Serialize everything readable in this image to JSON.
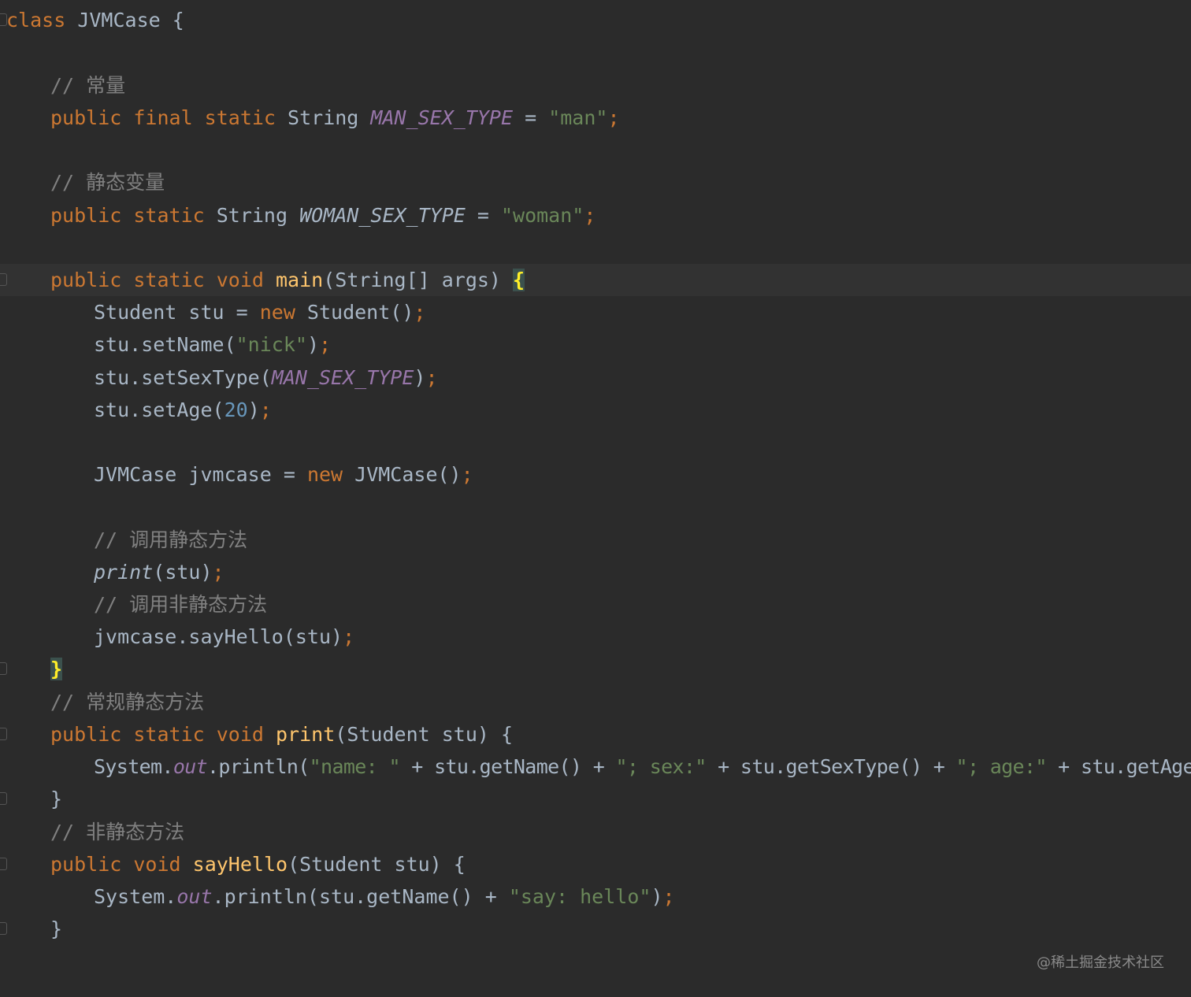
{
  "editor": {
    "lines": {
      "l1": {
        "class_kw": "class",
        "class_name": " JVMCase {"
      },
      "l3": {
        "comment": "// 常量"
      },
      "l4": {
        "kw": "public final static",
        "type": " String ",
        "const": "MAN_SEX_TYPE",
        "eq": " = ",
        "str": "\"man\"",
        "semi": ";"
      },
      "l6": {
        "comment": "// 静态变量"
      },
      "l7": {
        "kw": "public static",
        "type": " String ",
        "sfield": "WOMAN_SEX_TYPE",
        "eq": " = ",
        "str": "\"woman\"",
        "semi": ";"
      },
      "l9": {
        "kw": "public static void",
        "sp": " ",
        "fn": "main",
        "args": "(String[] args) ",
        "brace": "{"
      },
      "l10": {
        "text": "Student stu = ",
        "kw": "new",
        "rest": " Student()",
        "semi": ";"
      },
      "l11": {
        "text": "stu.setName(",
        "str": "\"nick\"",
        "close": ")",
        "semi": ";"
      },
      "l12": {
        "text": "stu.setSexType(",
        "const": "MAN_SEX_TYPE",
        "close": ")",
        "semi": ";"
      },
      "l13": {
        "text": "stu.setAge(",
        "num": "20",
        "close": ")",
        "semi": ";"
      },
      "l15": {
        "text": "JVMCase jvmcase = ",
        "kw": "new",
        "rest": " JVMCase()",
        "semi": ";"
      },
      "l17": {
        "comment": "// 调用静态方法"
      },
      "l18": {
        "call": "print",
        "rest": "(stu)",
        "semi": ";"
      },
      "l19": {
        "comment": "// 调用非静态方法"
      },
      "l20": {
        "text": "jvmcase.sayHello(stu)",
        "semi": ";"
      },
      "l21": {
        "brace": "}"
      },
      "l22": {
        "comment": "// 常规静态方法"
      },
      "l23": {
        "kw": "public static void",
        "sp": " ",
        "fn": "print",
        "rest": "(Student stu) {"
      },
      "l24": {
        "sys": "System.",
        "field": "out",
        "p1": ".println(",
        "s1": "\"name: \"",
        "p2": " + stu.getName() + ",
        "s2": "\"; sex:\"",
        "p3": " + stu.getSexType() + ",
        "s3": "\"; age:\"",
        "p4": " + stu.getAge())",
        "semi": ";"
      },
      "l25": {
        "brace": "}"
      },
      "l26": {
        "comment": "// 非静态方法"
      },
      "l27": {
        "kw": "public void",
        "sp": " ",
        "fn": "sayHello",
        "rest": "(Student stu) {"
      },
      "l28": {
        "sys": "System.",
        "field": "out",
        "p1": ".println(stu.getName() + ",
        "s1": "\"say: hello\"",
        "close": ")",
        "semi": ";"
      },
      "l29": {
        "brace": "}"
      }
    }
  },
  "watermark": "@稀土掘金技术社区"
}
